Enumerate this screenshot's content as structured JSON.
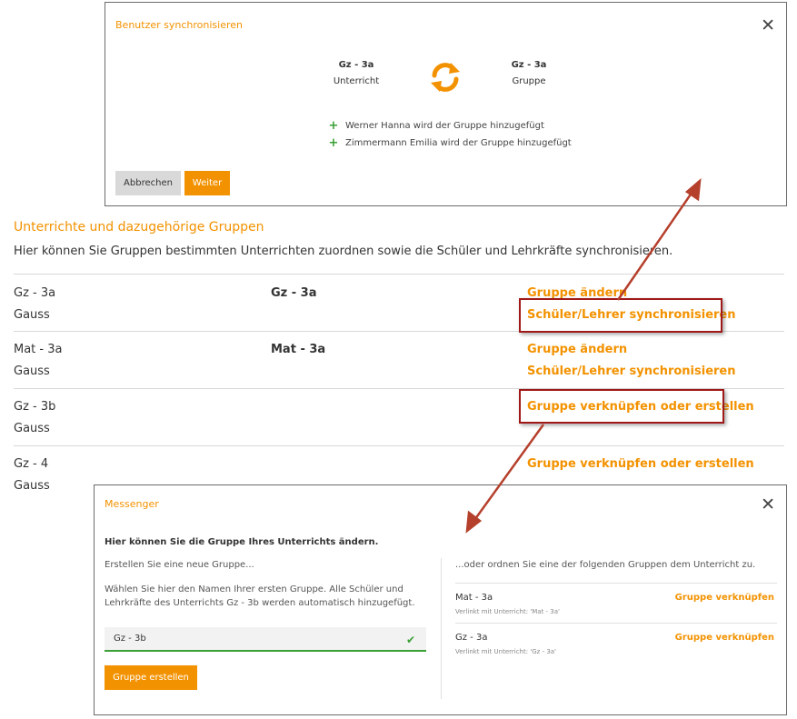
{
  "sync_modal": {
    "title": "Benutzer synchronisieren",
    "close": "✕",
    "left": {
      "name": "Gz - 3a",
      "type": "Unterricht"
    },
    "right": {
      "name": "Gz - 3a",
      "type": "Gruppe"
    },
    "changes": [
      "Werner Hanna wird der Gruppe hinzugefügt",
      "Zimmermann Emilia wird der Gruppe hinzugefügt"
    ],
    "cancel_label": "Abbrechen",
    "next_label": "Weiter",
    "sync_icon": "refresh-icon",
    "accent": "#f39200"
  },
  "section": {
    "title": "Unterrichte und dazugehörige Gruppen",
    "description": "Hier können Sie Gruppen bestimmten Unterrichten zuordnen sowie die Schüler und Lehrkräfte synchronisieren.",
    "rows": [
      {
        "course": "Gz - 3a",
        "teacher": "Gauss",
        "group": "Gz - 3a",
        "actions": [
          "Gruppe ändern",
          "Schüler/Lehrer synchronisieren"
        ]
      },
      {
        "course": "Mat - 3a",
        "teacher": "Gauss",
        "group": "Mat - 3a",
        "actions": [
          "Gruppe ändern",
          "Schüler/Lehrer synchronisieren"
        ]
      },
      {
        "course": "Gz - 3b",
        "teacher": "Gauss",
        "group": "",
        "actions": [
          "Gruppe verknüpfen oder erstellen"
        ]
      },
      {
        "course": "Gz - 4",
        "teacher": "Gauss",
        "group": "",
        "actions": [
          "Gruppe verknüpfen oder erstellen"
        ]
      }
    ]
  },
  "messenger_modal": {
    "title": "Messenger",
    "close": "✕",
    "heading": "Hier können Sie die Gruppe Ihres Unterrichts ändern.",
    "left_sub": "Erstellen Sie eine neue Gruppe...",
    "left_text": "Wählen Sie hier den Namen Ihrer ersten Gruppe. Alle Schüler und Lehrkräfte des Unterrichts Gz - 3b werden automatisch hinzugefügt.",
    "input_value": "Gz - 3b",
    "create_label": "Gruppe erstellen",
    "right_sub": "...oder ordnen Sie eine der folgenden Gruppen dem Unterricht zu.",
    "groups": [
      {
        "name": "Mat - 3a",
        "linked": "Verlinkt mit Unterricht: 'Mat - 3a'",
        "action": "Gruppe verknüpfen"
      },
      {
        "name": "Gz - 3a",
        "linked": "Verlinkt mit Unterricht: 'Gz - 3a'",
        "action": "Gruppe verknüpfen"
      }
    ]
  },
  "colors": {
    "accent": "#f39200",
    "success": "#3aa035",
    "highlight": "#a01818"
  }
}
